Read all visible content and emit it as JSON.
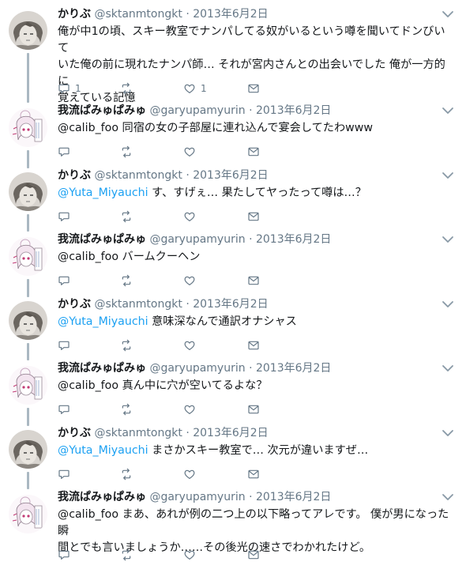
{
  "users": {
    "karibu": {
      "name": "かりぶ",
      "handle": "@sktanmtongkt"
    },
    "garyu": {
      "name": "我流ぱみゅぱみゅ",
      "handle": "@garyupamyurin"
    }
  },
  "separator": "·",
  "tweets": [
    {
      "user": "karibu",
      "date": "2013年6月2日",
      "lines": [
        "俺が中1の頃、スキー教室でナンパしてる奴がいるという噂を聞いてドンびいて",
        "いた俺の前に現れたナンパ師… それが宮内さんとの出会いでした 俺が一方的に",
        "覚えている記憶"
      ],
      "reply_count": "1",
      "like_count": "1"
    },
    {
      "user": "garyu",
      "date": "2013年6月2日",
      "lines": [
        "@calib_foo 同宿の女の子部屋に連れ込んで宴会してたわwww"
      ]
    },
    {
      "user": "karibu",
      "date": "2013年6月2日",
      "mention": "@Yuta_Miyauchi",
      "lines": [
        " す、すげぇ… 果たしてヤったって噂は…？"
      ]
    },
    {
      "user": "garyu",
      "date": "2013年6月2日",
      "lines": [
        "@calib_foo バームクーヘン"
      ]
    },
    {
      "user": "karibu",
      "date": "2013年6月2日",
      "mention": "@Yuta_Miyauchi",
      "lines": [
        " 意味深なんで通訳オナシャス"
      ]
    },
    {
      "user": "garyu",
      "date": "2013年6月2日",
      "lines": [
        "@calib_foo 真ん中に穴が空いてるよな？"
      ]
    },
    {
      "user": "karibu",
      "date": "2013年6月2日",
      "mention": "@Yuta_Miyauchi",
      "lines": [
        " まさかスキー教室で… 次元が違いますぜ…"
      ]
    },
    {
      "user": "garyu",
      "date": "2013年6月2日",
      "lines": [
        "@calib_foo まあ、あれが例の二つ上の以下略ってアレです。 僕が男になった瞬",
        "間とでも言いましょうか……その後光の速さでわかれたけど。"
      ]
    }
  ],
  "icons": [
    "reply-icon",
    "retweet-icon",
    "like-icon",
    "dm-icon",
    "chevron-down-icon"
  ],
  "colors": {
    "text": "#14171a",
    "muted": "#657786",
    "link": "#1da1f2",
    "thread": "#aab8c2"
  }
}
